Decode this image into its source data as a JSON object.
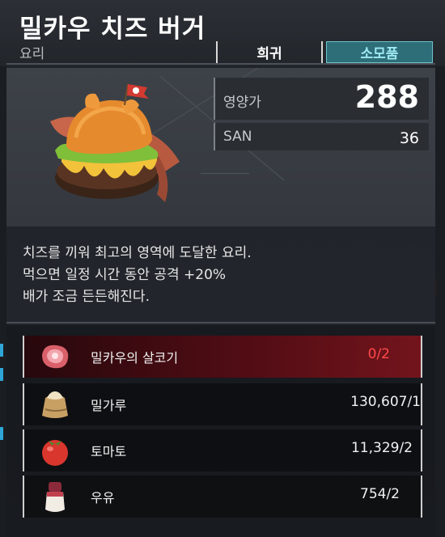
{
  "item": {
    "title": "밀카우 치즈 버거",
    "category": "요리",
    "rarity": "희귀",
    "type": "소모품"
  },
  "stats": [
    {
      "label": "영양가",
      "value": "288"
    },
    {
      "label": "SAN",
      "value": "36"
    }
  ],
  "description": [
    "치즈를 끼워 최고의 영역에 도달한 요리.",
    "먹으면 일정 시간 동안 공격 +20%",
    "배가 조금 든든해진다."
  ],
  "ingredients": [
    {
      "name": "밀카우의 살코기",
      "count": "0/2",
      "icon": "meat-icon",
      "insufficient": true
    },
    {
      "name": "밀가루",
      "count": "130,607/1",
      "icon": "flour-sack-icon",
      "insufficient": false
    },
    {
      "name": "토마토",
      "count": "11,329/2",
      "icon": "tomato-icon",
      "insufficient": false
    },
    {
      "name": "우유",
      "count": "754/2",
      "icon": "milk-bottle-icon",
      "insufficient": false
    }
  ],
  "colors": {
    "accent_type": "#2d6e79",
    "insufficient": "#ff4a4a",
    "side_marker": "#2ea6d8"
  }
}
